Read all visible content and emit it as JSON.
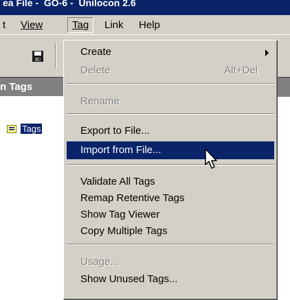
{
  "window": {
    "title_fragment": "ea File -  GO-6 -  Unilocon 2.6"
  },
  "menubar": {
    "items": [
      {
        "label": "t"
      },
      {
        "label": "View",
        "mnemonic": "V"
      },
      {
        "label": "Tag",
        "mnemonic": "T",
        "open": true
      },
      {
        "label": "Link",
        "mnemonic": "L"
      },
      {
        "label": "Help",
        "mnemonic": "H"
      }
    ]
  },
  "toolbar": {
    "icons": [
      "save-icon"
    ]
  },
  "panel": {
    "header": "n Tags"
  },
  "tree": {
    "selected_label": "Tags",
    "icon": "tag-folder-icon"
  },
  "menu": {
    "items": [
      {
        "label": "Create",
        "mnemonic": "C",
        "submenu": true
      },
      {
        "label": "Delete",
        "mnemonic": "D",
        "shortcut": "Alt+Del",
        "disabled": true
      },
      {
        "label": "Rename",
        "mnemonic": "R",
        "disabled": true
      },
      {
        "label": "Export to File...",
        "mnemonic": "x"
      },
      {
        "label": "Import from File...",
        "mnemonic": "p",
        "highlighted": true
      },
      {
        "label": "Validate All Tags",
        "mnemonic": "V"
      },
      {
        "label": "Remap Retentive Tags",
        "mnemonic": "m"
      },
      {
        "label": "Show Tag Viewer",
        "mnemonic": "S"
      },
      {
        "label": "Copy Multiple Tags",
        "mnemonic": "o"
      },
      {
        "label": "Usage...",
        "mnemonic": "U",
        "disabled": true
      },
      {
        "label": "Show Unused Tags...",
        "mnemonic": "h"
      }
    ]
  },
  "colors": {
    "face": "#d4d0c8",
    "highlight": "#0a246a",
    "disabled_text": "#808080",
    "panel_header": "#808080"
  }
}
